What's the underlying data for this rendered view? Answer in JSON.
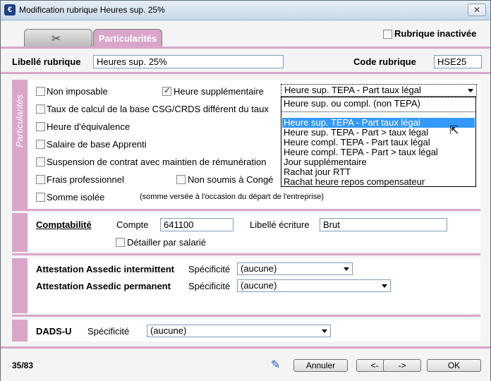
{
  "window": {
    "title": "Modification rubrique Heures sup. 25%",
    "close_glyph": "✕"
  },
  "tabs": [
    {
      "label": "",
      "icon": "wrench-icon"
    },
    {
      "label": "Particularités"
    }
  ],
  "header": {
    "inactive_label": "Rubrique inactivée",
    "libelle_label": "Libellé rubrique",
    "libelle_value": "Heures sup. 25%",
    "code_label": "Code rubrique",
    "code_value": "HSE25"
  },
  "particularites": {
    "section_label": "Particularités",
    "non_imposable": "Non imposable",
    "heure_sup": "Heure supplémentaire",
    "heure_sup_select": "Heure sup. TEPA - Part taux légal",
    "taux_csg": "Taux de calcul de la base CSG/CRDS différent du taux",
    "heure_equiv": "Heure d'équivalence",
    "salaire_apprenti": "Salaire de base Apprenti",
    "suspension": "Suspension de contrat avec maintien de rémunération",
    "frais_pro": "Frais professionnel",
    "non_soumis": "Non soumis à Congé",
    "somme_isolee": "Somme isolée",
    "somme_note": "(somme versée à l'occasion du départ de l'entreprise)"
  },
  "dropdown": {
    "items": [
      "Heure sup. ou compl. (non TEPA)",
      "",
      "Heure sup. TEPA - Part taux légal",
      "Heure sup. TEPA - Part > taux légal",
      "Heure compl. TEPA - Part taux légal",
      "Heure compl. TEPA - Part > taux légal",
      "Jour supplémentaire",
      "Rachat jour RTT",
      "Rachat heure repos compensateur"
    ]
  },
  "comptabilite": {
    "label": "Comptabilité",
    "compte_label": "Compte",
    "compte_value": "641100",
    "libelle_label": "Libellé écriture",
    "libelle_value": "Brut",
    "detail_label": "Détailler par salarié"
  },
  "assedic": {
    "intermittent_label": "Attestation Assedic intermittent",
    "permanent_label": "Attestation Assedic permanent",
    "specificite_label": "Spécificité",
    "intermittent_value": "(aucune)",
    "permanent_value": "(aucune)"
  },
  "dads": {
    "label": "DADS-U",
    "specificite_label": "Spécificité",
    "value": "(aucune)"
  },
  "footer": {
    "counter": "35/83",
    "annuler": "Annuler",
    "prev": "<-",
    "next": "->",
    "ok": "OK"
  },
  "colors": {
    "accent": "#d9a6c9",
    "selection": "#3399ff"
  }
}
